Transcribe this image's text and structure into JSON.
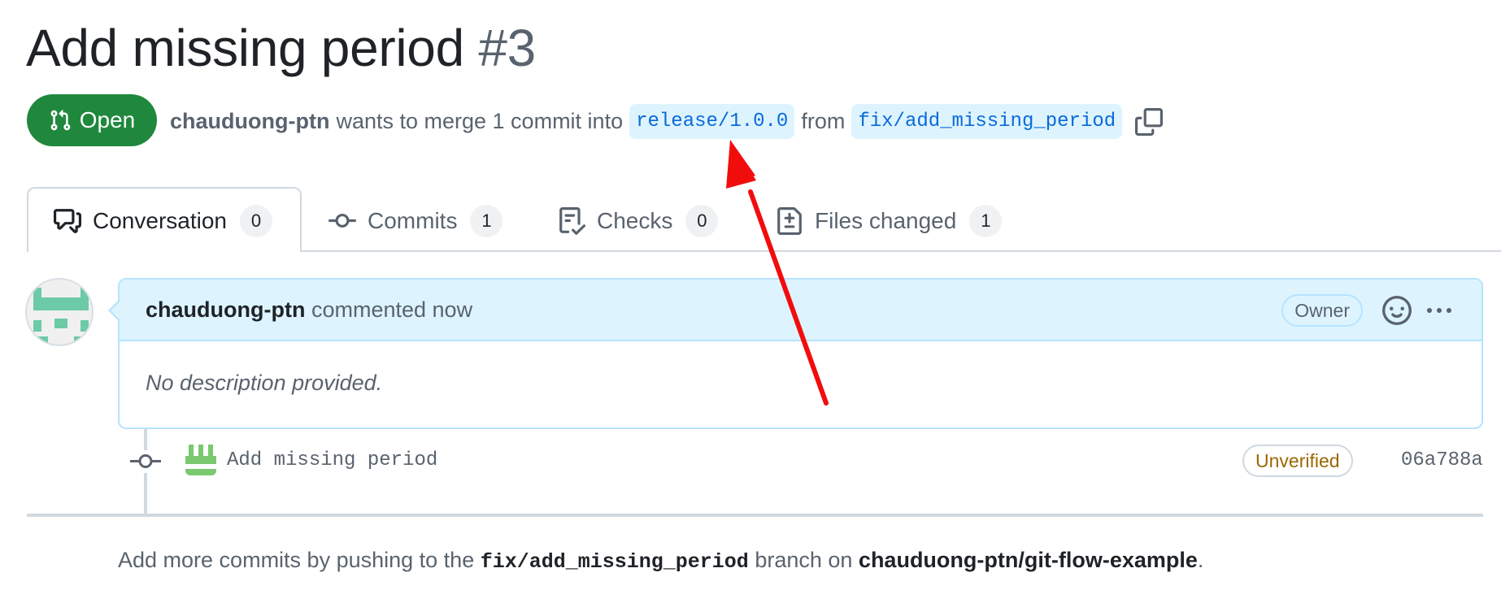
{
  "pr": {
    "title": "Add missing period",
    "number": "#3",
    "state": "Open",
    "author": "chauduong-ptn",
    "merge_text": "wants to merge 1 commit into",
    "base_branch": "release/1.0.0",
    "from_text": "from",
    "head_branch": "fix/add_missing_period"
  },
  "tabs": [
    {
      "label": "Conversation",
      "count": "0",
      "icon": "conversation-icon"
    },
    {
      "label": "Commits",
      "count": "1",
      "icon": "commit-icon"
    },
    {
      "label": "Checks",
      "count": "0",
      "icon": "checklist-icon"
    },
    {
      "label": "Files changed",
      "count": "1",
      "icon": "file-diff-icon"
    }
  ],
  "comment": {
    "author": "chauduong-ptn",
    "action": "commented now",
    "role_badge": "Owner",
    "body": "No description provided."
  },
  "commit": {
    "message": "Add missing period",
    "verification": "Unverified",
    "sha": "06a788a"
  },
  "footer": {
    "prefix": "Add more commits by pushing to the",
    "branch": "fix/add_missing_period",
    "middle": "branch on",
    "repo": "chauduong-ptn/git-flow-example",
    "suffix": "."
  },
  "colors": {
    "open_green": "#1f883d",
    "branch_blue": "#0969da",
    "branch_bg": "#ddf4ff",
    "annotation_red": "#f20d0d",
    "unverified_amber": "#9a6700"
  }
}
